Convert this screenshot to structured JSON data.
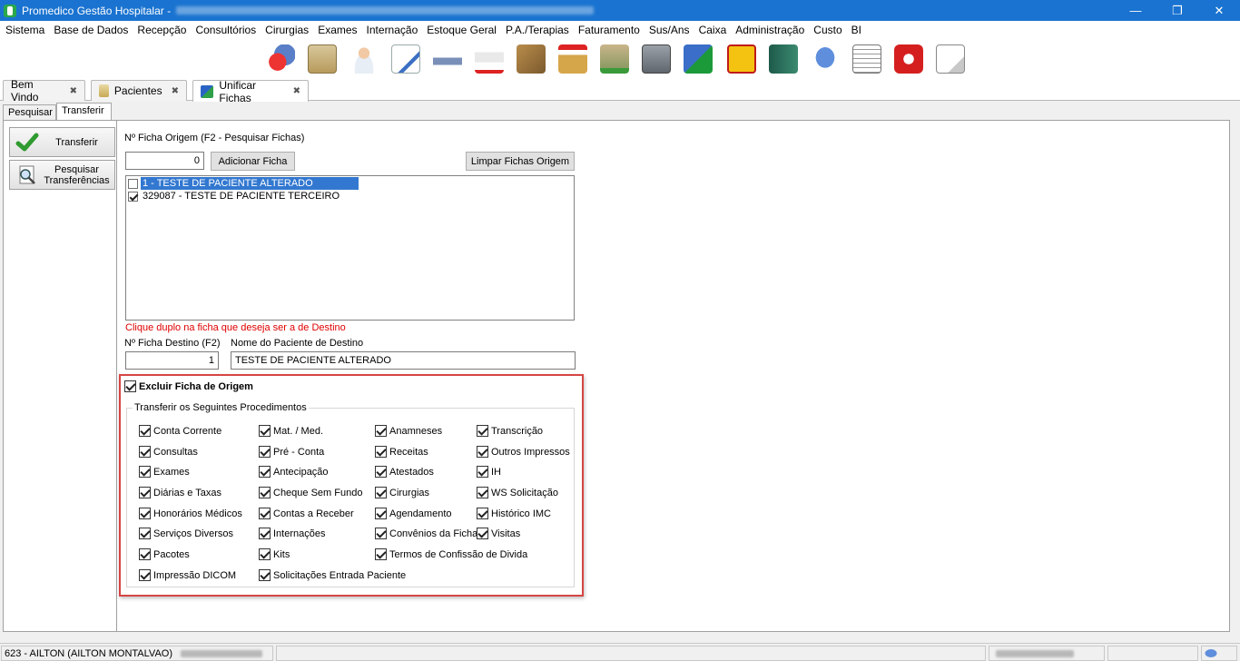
{
  "window": {
    "title": "Promedico Gestão Hospitalar - ",
    "minimize_glyph": "—",
    "restore_glyph": "❐",
    "close_glyph": "✕"
  },
  "menu": [
    "Sistema",
    "Base de Dados",
    "Recepção",
    "Consultórios",
    "Cirurgias",
    "Exames",
    "Internação",
    "Estoque Geral",
    "P.A./Terapias",
    "Faturamento",
    "Sus/Ans",
    "Caixa",
    "Administração",
    "Custo",
    "BI"
  ],
  "toolbar_icons": [
    "globe-users-icon",
    "reception-icon",
    "doctor-icon",
    "prescription-icon",
    "ambulance-bed-icon",
    "ambulance-icon",
    "stock-boxes-icon",
    "stock-up-icon",
    "stock-down-icon",
    "safe-icon",
    "finance-chart-icon",
    "phone-book-icon",
    "book-icon",
    "chat-icon",
    "calendar-grid-icon",
    "power-icon",
    "document-icon"
  ],
  "doc_tabs": [
    {
      "label": "Bem Vindo",
      "close": "✖"
    },
    {
      "label": "Pacientes",
      "close": "✖"
    },
    {
      "label": "Unificar Fichas",
      "close": "✖"
    }
  ],
  "sub_tabs": [
    "Pesquisar",
    "Transferir"
  ],
  "left_buttons": {
    "transferir": "Transferir",
    "pesquisar_line1": "Pesquisar",
    "pesquisar_line2": "Transferências"
  },
  "form": {
    "origem_label": "Nº Ficha Origem (F2 - Pesquisar Fichas)",
    "origem_value": "0",
    "adicionar_button": "Adicionar Ficha",
    "limpar_button": "Limpar Fichas Origem",
    "fichas": [
      {
        "text": "1 - TESTE DE PACIENTE ALTERADO",
        "checked": false,
        "selected": true
      },
      {
        "text": "329087 - TESTE DE PACIENTE TERCEIRO",
        "checked": true,
        "selected": false
      }
    ],
    "hint": "Clique duplo na ficha que deseja ser a de Destino",
    "hint_color": "#e00000",
    "destino_label": "Nº Ficha Destino (F2)",
    "destino_value": "1",
    "nome_label": "Nome do Paciente de Destino",
    "nome_value": "TESTE DE PACIENTE ALTERADO"
  },
  "excluir": {
    "label": "Excluir Ficha de Origem",
    "checked": true
  },
  "procedimentos": {
    "title": "Transferir os Seguintes Procedimentos",
    "col1": [
      "Conta Corrente",
      "Consultas",
      "Exames",
      "Diárias e Taxas",
      "Honorários Médicos",
      "Serviços Diversos",
      "Pacotes",
      "Impressão DICOM"
    ],
    "col2": [
      "Mat. / Med.",
      "Pré - Conta",
      "Antecipação",
      "Cheque Sem Fundo",
      "Contas a Receber",
      "Internações",
      "Kits",
      "Solicitações Entrada Paciente"
    ],
    "col3": [
      "Anamneses",
      "Receitas",
      "Atestados",
      "Cirurgias",
      "Agendamento",
      "Convênios da Ficha",
      "Termos de Confissão de Divida"
    ],
    "col4": [
      "Transcrição",
      "Outros Impressos",
      "IH",
      "WS Solicitação",
      "Histórico IMC",
      "Visitas"
    ]
  },
  "status": {
    "user": "623 - AILTON (AILTON MONTALVAO)"
  },
  "colors": {
    "titlebar": "#1a73d0",
    "selection": "#3378d0",
    "highlight_frame": "#d64545"
  }
}
